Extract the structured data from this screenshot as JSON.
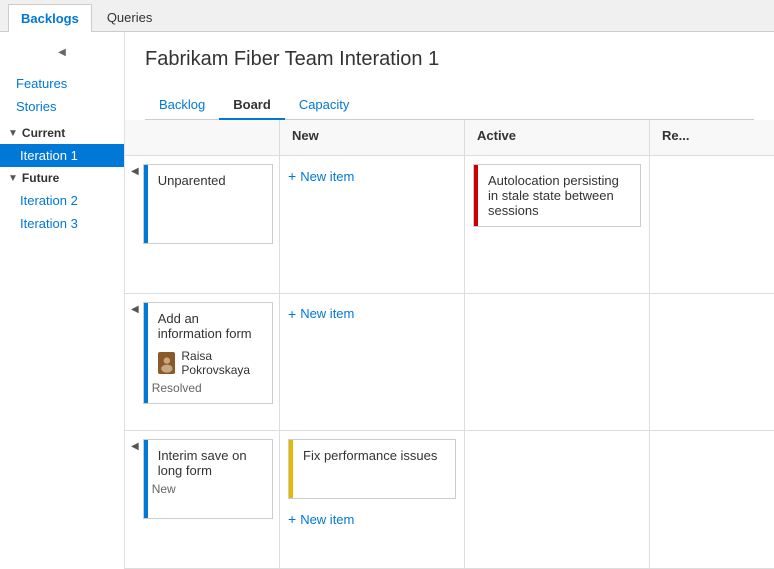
{
  "topTabs": [
    {
      "id": "backlogs",
      "label": "Backlogs",
      "active": true
    },
    {
      "id": "queries",
      "label": "Queries",
      "active": false
    }
  ],
  "sidebar": {
    "toggleLabel": "◀",
    "links": [
      {
        "id": "features",
        "label": "Features"
      },
      {
        "id": "stories",
        "label": "Stories"
      }
    ],
    "sections": [
      {
        "id": "current",
        "label": "Current",
        "items": [
          {
            "id": "iteration-1",
            "label": "Iteration 1",
            "active": true
          }
        ]
      },
      {
        "id": "future",
        "label": "Future",
        "items": [
          {
            "id": "iteration-2",
            "label": "Iteration 2",
            "active": false
          },
          {
            "id": "iteration-3",
            "label": "Iteration 3",
            "active": false
          }
        ]
      }
    ]
  },
  "page": {
    "title": "Fabrikam Fiber Team Interation 1",
    "subTabs": [
      {
        "id": "backlog",
        "label": "Backlog",
        "active": false
      },
      {
        "id": "board",
        "label": "Board",
        "active": true
      },
      {
        "id": "capacity",
        "label": "Capacity",
        "active": false
      }
    ]
  },
  "board": {
    "columns": [
      {
        "id": "new",
        "label": "New"
      },
      {
        "id": "active",
        "label": "Active"
      },
      {
        "id": "resolved",
        "label": "Re..."
      }
    ],
    "rows": [
      {
        "id": "unparented",
        "label": "Unparented",
        "status": "",
        "barColor": "blue",
        "cells": {
          "new": {
            "newItemLabel": "New item",
            "cards": []
          },
          "active": {
            "newItemLabel": "",
            "cards": [
              {
                "id": "card-autolocation",
                "text": "Autolocation persisting in stale state between sessions",
                "barColor": "red"
              }
            ]
          },
          "resolved": {
            "cards": []
          }
        }
      },
      {
        "id": "add-info-form",
        "label": "Add an information form",
        "status": "Resolved",
        "barColor": "blue",
        "assignee": "Raisa Pokrovskaya",
        "cells": {
          "new": {
            "newItemLabel": "New item",
            "cards": []
          },
          "active": {
            "newItemLabel": "",
            "cards": []
          },
          "resolved": {
            "cards": []
          }
        }
      },
      {
        "id": "interim-save",
        "label": "Interim save on long form",
        "status": "New",
        "barColor": "blue",
        "cells": {
          "new": {
            "newItemLabel": "New item",
            "cards": [
              {
                "id": "card-performance",
                "text": "Fix performance issues",
                "barColor": "yellow"
              }
            ]
          },
          "active": {
            "newItemLabel": "",
            "cards": []
          },
          "resolved": {
            "cards": []
          }
        }
      }
    ]
  }
}
